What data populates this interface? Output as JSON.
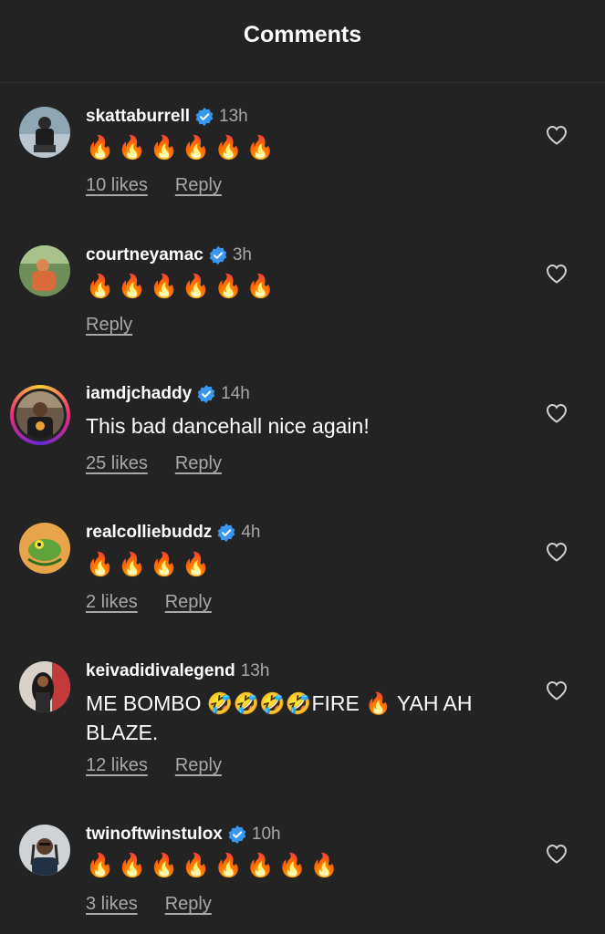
{
  "header": {
    "title": "Comments"
  },
  "comments": [
    {
      "username": "skattaburrell",
      "verified": true,
      "time": "13h",
      "text": "🔥🔥🔥🔥🔥🔥",
      "likes": "10 likes",
      "reply": "Reply"
    },
    {
      "username": "courtneyamac",
      "verified": true,
      "time": "3h",
      "text": "🔥🔥🔥🔥🔥🔥",
      "likes": "",
      "reply": "Reply"
    },
    {
      "username": "iamdjchaddy",
      "verified": true,
      "time": "14h",
      "text": "This bad dancehall nice again!",
      "likes": "25 likes",
      "reply": "Reply"
    },
    {
      "username": "realcolliebuddz",
      "verified": true,
      "time": "4h",
      "text": "🔥🔥🔥🔥",
      "likes": "2 likes",
      "reply": "Reply"
    },
    {
      "username": "keivadidivalegend",
      "verified": false,
      "time": "13h",
      "text": "ME BOMBO 🤣🤣🤣🤣FIRE 🔥 YAH AH BLAZE.",
      "likes": "12 likes",
      "reply": "Reply"
    },
    {
      "username": "twinoftwinstulox",
      "verified": true,
      "time": "10h",
      "text": "🔥🔥🔥🔥🔥🔥🔥🔥",
      "likes": "3 likes",
      "reply": "Reply"
    }
  ],
  "colors": {
    "background": "#232323",
    "verified": "#3897f0",
    "muted": "#a8a8a8"
  }
}
